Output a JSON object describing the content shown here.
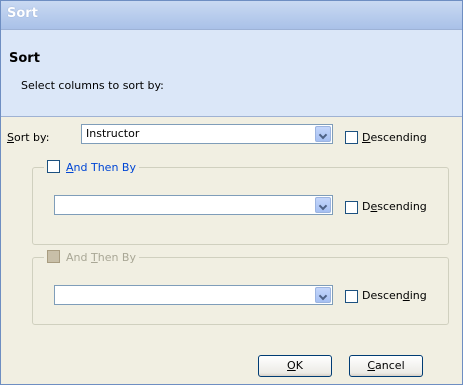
{
  "window": {
    "title": "Sort"
  },
  "header": {
    "title": "Sort",
    "subtitle": "Select columns to sort by:"
  },
  "sort_by": {
    "label_pre": "",
    "label_ul": "S",
    "label_post": "ort by:",
    "value": "Instructor",
    "descending": {
      "pre": "",
      "ul": "D",
      "post": "escending",
      "checked": false
    }
  },
  "then_by_1": {
    "header_pre": "",
    "header_ul": "A",
    "header_post": "nd Then By",
    "enabled": true,
    "value": "",
    "descending": {
      "pre": "D",
      "ul": "e",
      "post": "scending",
      "checked": false
    }
  },
  "then_by_2": {
    "header_pre": "And ",
    "header_ul": "T",
    "header_post": "hen By",
    "enabled": false,
    "value": "",
    "descending": {
      "pre": "Descen",
      "ul": "d",
      "post": "ing",
      "checked": false
    }
  },
  "buttons": {
    "ok": {
      "pre": "",
      "ul": "O",
      "post": "K"
    },
    "cancel": {
      "pre": "",
      "ul": "C",
      "post": "ancel"
    }
  }
}
